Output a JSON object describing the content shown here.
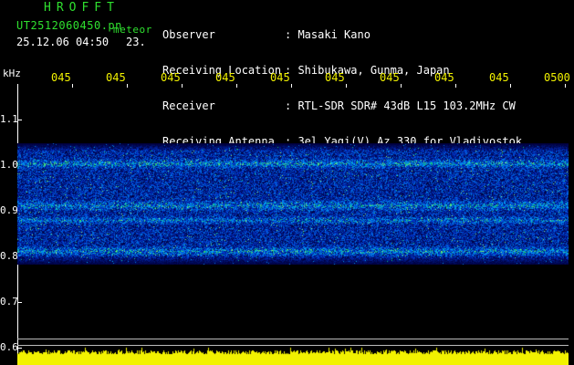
{
  "header": {
    "app_title": "HROFFT",
    "file_name": "UT2512060450.pn",
    "mode": "meteor",
    "timestamp": "25.12.06 04:50",
    "count": "23."
  },
  "info": [
    {
      "label": "Observer",
      "value": ": Masaki Kano"
    },
    {
      "label": "Receiving Location",
      "value": ": Shibukawa, Gunma, Japan"
    },
    {
      "label": "Receiver",
      "value": ": RTL-SDR SDR# 43dB L15 103.2MHz CW"
    },
    {
      "label": "Receiving Antenna",
      "value": ": 3el Yagi(V) Az 330 for Vladivostok"
    }
  ],
  "axis": {
    "unit": "kHz",
    "time_labels": [
      "045",
      "045",
      "045",
      "045",
      "045",
      "045",
      "045",
      "045",
      "045",
      "0500"
    ],
    "freq_labels": [
      "1.1",
      "1.0",
      "0.9",
      "0.8",
      "0.7",
      "0.6"
    ]
  },
  "colors": {
    "text_info": "#ffffff",
    "text_title": "#2fe02f",
    "axis_time": "#f2f200",
    "meter": "#f2f200",
    "spectrogram_base": "#0a1e8c"
  }
}
